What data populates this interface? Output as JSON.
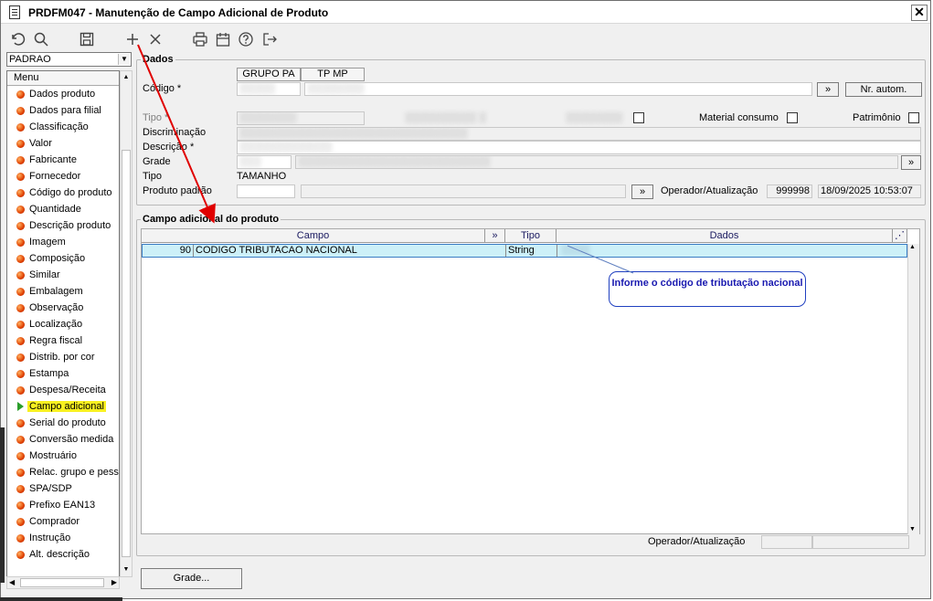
{
  "window": {
    "title": "PRDFM047 - Manutenção de Campo Adicional de Produto",
    "close_label": "✕"
  },
  "toolbar": {
    "icons": [
      "undo-icon",
      "search-icon",
      "save-icon",
      "add-icon",
      "delete-icon",
      "print-icon",
      "calendar-icon",
      "help-icon",
      "exit-icon"
    ]
  },
  "left": {
    "combo_value": "PADRAO",
    "menu_header": "Menu",
    "items": [
      "Dados produto",
      "Dados para filial",
      "Classificação",
      "Valor",
      "Fabricante",
      "Fornecedor",
      "Código do produto",
      "Quantidade",
      "Descrição produto",
      "Imagem",
      "Composição",
      "Similar",
      "Embalagem",
      "Observação",
      "Localização",
      "Regra fiscal",
      "Distrib. por cor",
      "Estampa",
      "Despesa/Receita",
      "Campo adicional",
      "Serial do produto",
      "Conversão medida",
      "Mostruário",
      "Relac. grupo e pess",
      "SPA/SDP",
      "Prefixo EAN13",
      "Comprador",
      "Instrução",
      "Alt. descrição"
    ],
    "active_item": "Campo adicional"
  },
  "dados": {
    "legend": "Dados",
    "tab_grupo": "GRUPO PA",
    "tab_tpmp": "TP MP",
    "codigo_label": "Código *",
    "tipo_label": "Tipo *",
    "discriminacao_label": "Discriminação",
    "descricao_label": "Descrição *",
    "grade_label": "Grade",
    "tipo2_label": "Tipo",
    "tipo2_value": "TAMANHO",
    "produto_padrao_label": "Produto padrão",
    "nr_autom_label": "Nr. autom.",
    "arrow_btn": "»",
    "material_consumo_label": "Material consumo",
    "patrimonio_label": "Patrimônio",
    "operador_label": "Operador/Atualização",
    "operador_code": "999998",
    "operador_datetime": "18/09/2025 10:53:07"
  },
  "campo": {
    "legend": "Campo adicional do produto",
    "headers": {
      "campo": "Campo",
      "tipo": "Tipo",
      "dados": "Dados",
      "expand": "»"
    },
    "rows": [
      {
        "num": "90",
        "campo": "CODIGO TRIBUTACAO NACIONAL",
        "tipo": "String",
        "dados": ""
      }
    ],
    "callout": "Informe o código de tributação nacional",
    "operador_label": "Operador/Atualização"
  },
  "footer": {
    "grade_button": "Grade..."
  },
  "colors": {
    "row_highlight": "#ccf0f8",
    "active_menu": "#f8f020",
    "arrow": "#e00000",
    "callout_text": "#1a1ab0"
  }
}
